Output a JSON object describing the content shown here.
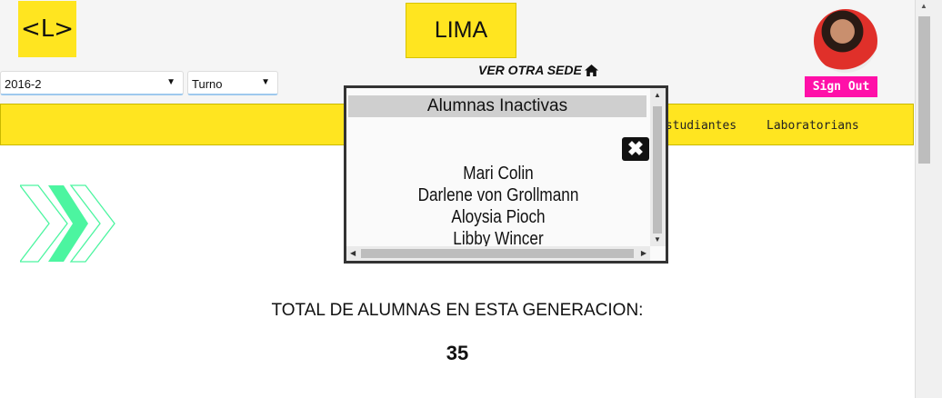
{
  "logo": {
    "text": "<L>"
  },
  "filters": {
    "generation": {
      "selected": "2016-2"
    },
    "turno": {
      "selected": "Turno"
    }
  },
  "sede": {
    "name": "LIMA",
    "ver_otra": "VER OTRA SEDE"
  },
  "user": {
    "signout_label": "Sign Out"
  },
  "nav": {
    "items": [
      "Estudiantes",
      "Laboratorians"
    ]
  },
  "modal": {
    "title": "Alumnas Inactivas",
    "close_icon": "close-icon",
    "students": [
      "Mari Colin",
      "Darlene von Grollmann",
      "Aloysia Pioch",
      "Libby Wincer"
    ]
  },
  "summary": {
    "total_label": "TOTAL DE ALUMNAS EN ESTA GENERACION:",
    "total_value": "35"
  },
  "colors": {
    "accent": "#ffe520",
    "signout": "#ff10a8",
    "chevron": "#4cf5a0"
  }
}
